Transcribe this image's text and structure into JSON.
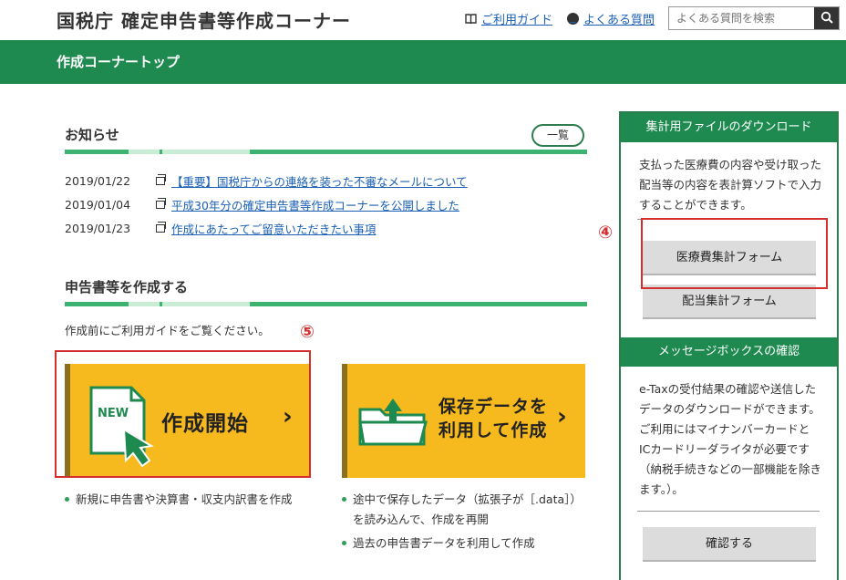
{
  "header": {
    "site_title": "国税庁 確定申告書等作成コーナー",
    "guide_link": "ご利用ガイド",
    "faq_link": "よくある質問",
    "search_placeholder": "よくある質問を検索"
  },
  "nav": {
    "title": "作成コーナートップ"
  },
  "news": {
    "title": "お知らせ",
    "list_button": "一覧",
    "items": [
      {
        "date": "2019/01/22",
        "text": "【重要】国税庁からの連絡を装った不審なメールについて"
      },
      {
        "date": "2019/01/04",
        "text": "平成30年分の確定申告書等作成コーナーを公開しました"
      },
      {
        "date": "2019/01/23",
        "text": "作成にあたってご留意いただきたい事項"
      }
    ]
  },
  "create": {
    "title": "申告書等を作成する",
    "intro": "作成前にご利用ガイドをご覧ください。",
    "start_card": {
      "badge": "NEW",
      "label": "作成開始"
    },
    "load_card": {
      "label_line1": "保存データを",
      "label_line2": "利用して作成"
    },
    "start_bullets": [
      "新規に申告書や決算書・収支内訳書を作成"
    ],
    "load_bullets": [
      "途中で保存したデータ（拡張子が［.data］）",
      "を読み込んで、作成を再開",
      "過去の申告書データを利用して作成"
    ]
  },
  "annotations": {
    "num4": "④",
    "num5": "⑤"
  },
  "sidebar": {
    "download_title": "集計用ファイルのダウンロード",
    "download_text": [
      "支払った医療費の内容や受け取った",
      "配当等の内容を表計算ソフトで入力",
      "することができます。"
    ],
    "medical_button": "医療費集計フォーム",
    "dividend_button": "配当集計フォーム",
    "message_title": "メッセージボックスの確認",
    "message_text": [
      "e-Taxの受付結果の確認や送信した",
      "データのダウンロードができます。",
      "ご利用にはマイナンバーカードと",
      "ICカードリーダライタが必要です",
      "（納税手続きなどの一部機能を除き",
      "ます。）。"
    ],
    "confirm_button": "確認する"
  },
  "colors": {
    "brand_green": "#1e8a50",
    "card_yellow": "#f6b91e",
    "annotation_red": "#d32f2f"
  }
}
